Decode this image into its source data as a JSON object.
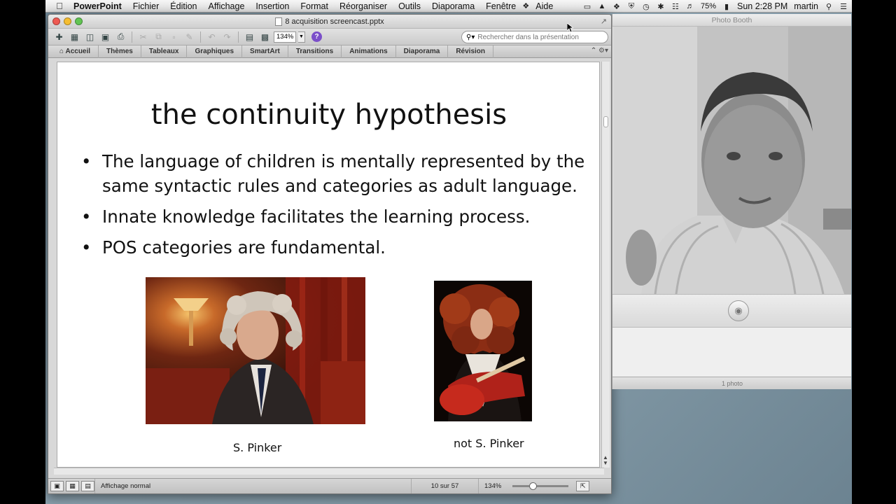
{
  "menubar": {
    "app_name": "PowerPoint",
    "items": [
      "Fichier",
      "Édition",
      "Affichage",
      "Insertion",
      "Format",
      "Réorganiser",
      "Outils",
      "Diaporama",
      "Fenêtre",
      "Aide"
    ],
    "battery": "75%",
    "clock": "Sun 2:28 PM",
    "user": "martin"
  },
  "ppt": {
    "window_title": "8 acquisition screencast.pptx",
    "zoom_box": "134%",
    "search_placeholder": "Rechercher dans la présentation",
    "ribbon_tabs": [
      "Accueil",
      "Thèmes",
      "Tableaux",
      "Graphiques",
      "SmartArt",
      "Transitions",
      "Animations",
      "Diaporama",
      "Révision"
    ],
    "slide": {
      "title": "the continuity hypothesis",
      "bullets": [
        "The language of children is mentally represented by the same syntactic rules and categories as adult language.",
        "Innate knowledge facilitates the learning process.",
        "POS categories are fundamental."
      ],
      "caption_left": "S. Pinker",
      "caption_right": "not S. Pinker"
    },
    "status": {
      "view_label": "Affichage normal",
      "slide_counter": "10 sur 57",
      "zoom": "134%"
    }
  },
  "photobooth": {
    "title": "Photo Booth",
    "photo_count": "1 photo"
  }
}
